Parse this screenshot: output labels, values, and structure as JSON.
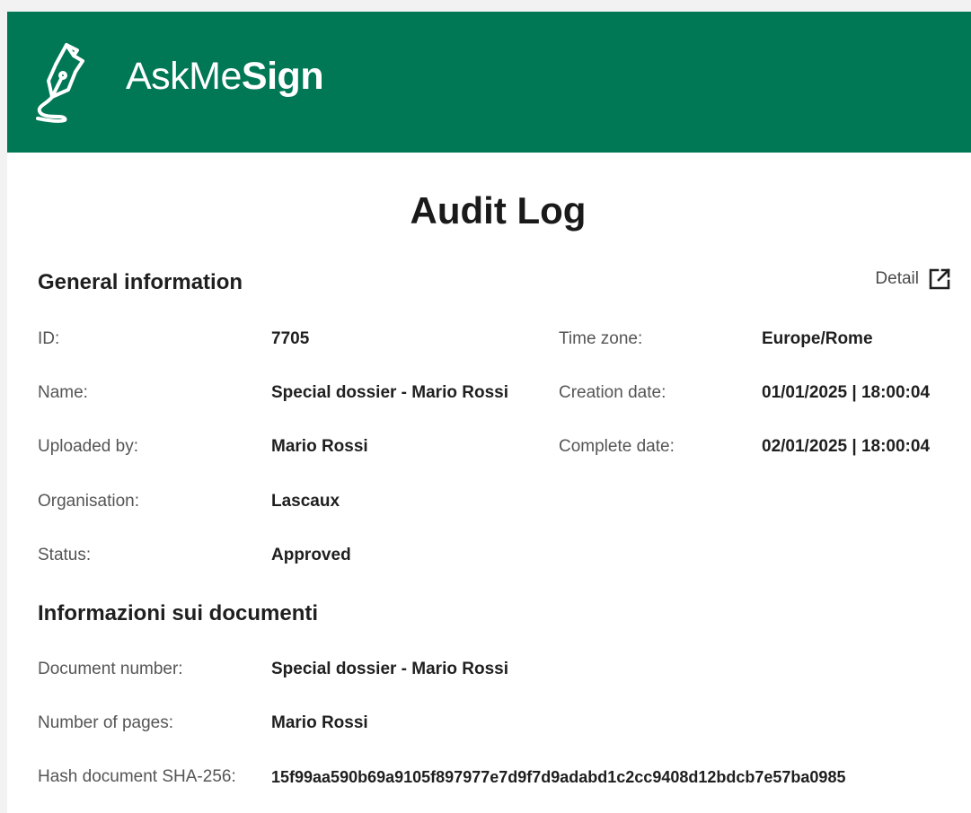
{
  "header": {
    "brand_light": "AskMe",
    "brand_bold": "Sign",
    "bg_color": "#007755"
  },
  "title": "Audit Log",
  "general": {
    "section_title": "General information",
    "detail_label": "Detail",
    "detail_icon": "external-link-icon",
    "left": [
      {
        "label": "ID:",
        "value": "7705"
      },
      {
        "label": "Name:",
        "value": "Special dossier - Mario Rossi"
      },
      {
        "label": "Uploaded by:",
        "value": "Mario Rossi"
      },
      {
        "label": "Organisation:",
        "value": "Lascaux"
      },
      {
        "label": "Status:",
        "value": "Approved"
      }
    ],
    "right": [
      {
        "label": "Time zone:",
        "value": "Europe/Rome"
      },
      {
        "label": "Creation date:",
        "value": "01/01/2025 | 18:00:04"
      },
      {
        "label": "Complete date:",
        "value": "02/01/2025 | 18:00:04"
      }
    ]
  },
  "documents": {
    "section_title": "Informazioni sui documenti",
    "rows": [
      {
        "label": "Document number:",
        "value": "Special dossier - Mario Rossi"
      },
      {
        "label": "Number of pages:",
        "value": "Mario Rossi"
      },
      {
        "label": "Hash document SHA-256:",
        "value": "15f99aa590b69a9105f897977e7d9f7d9adabd1c2cc9408d12bdcb7e57ba0985"
      }
    ]
  }
}
